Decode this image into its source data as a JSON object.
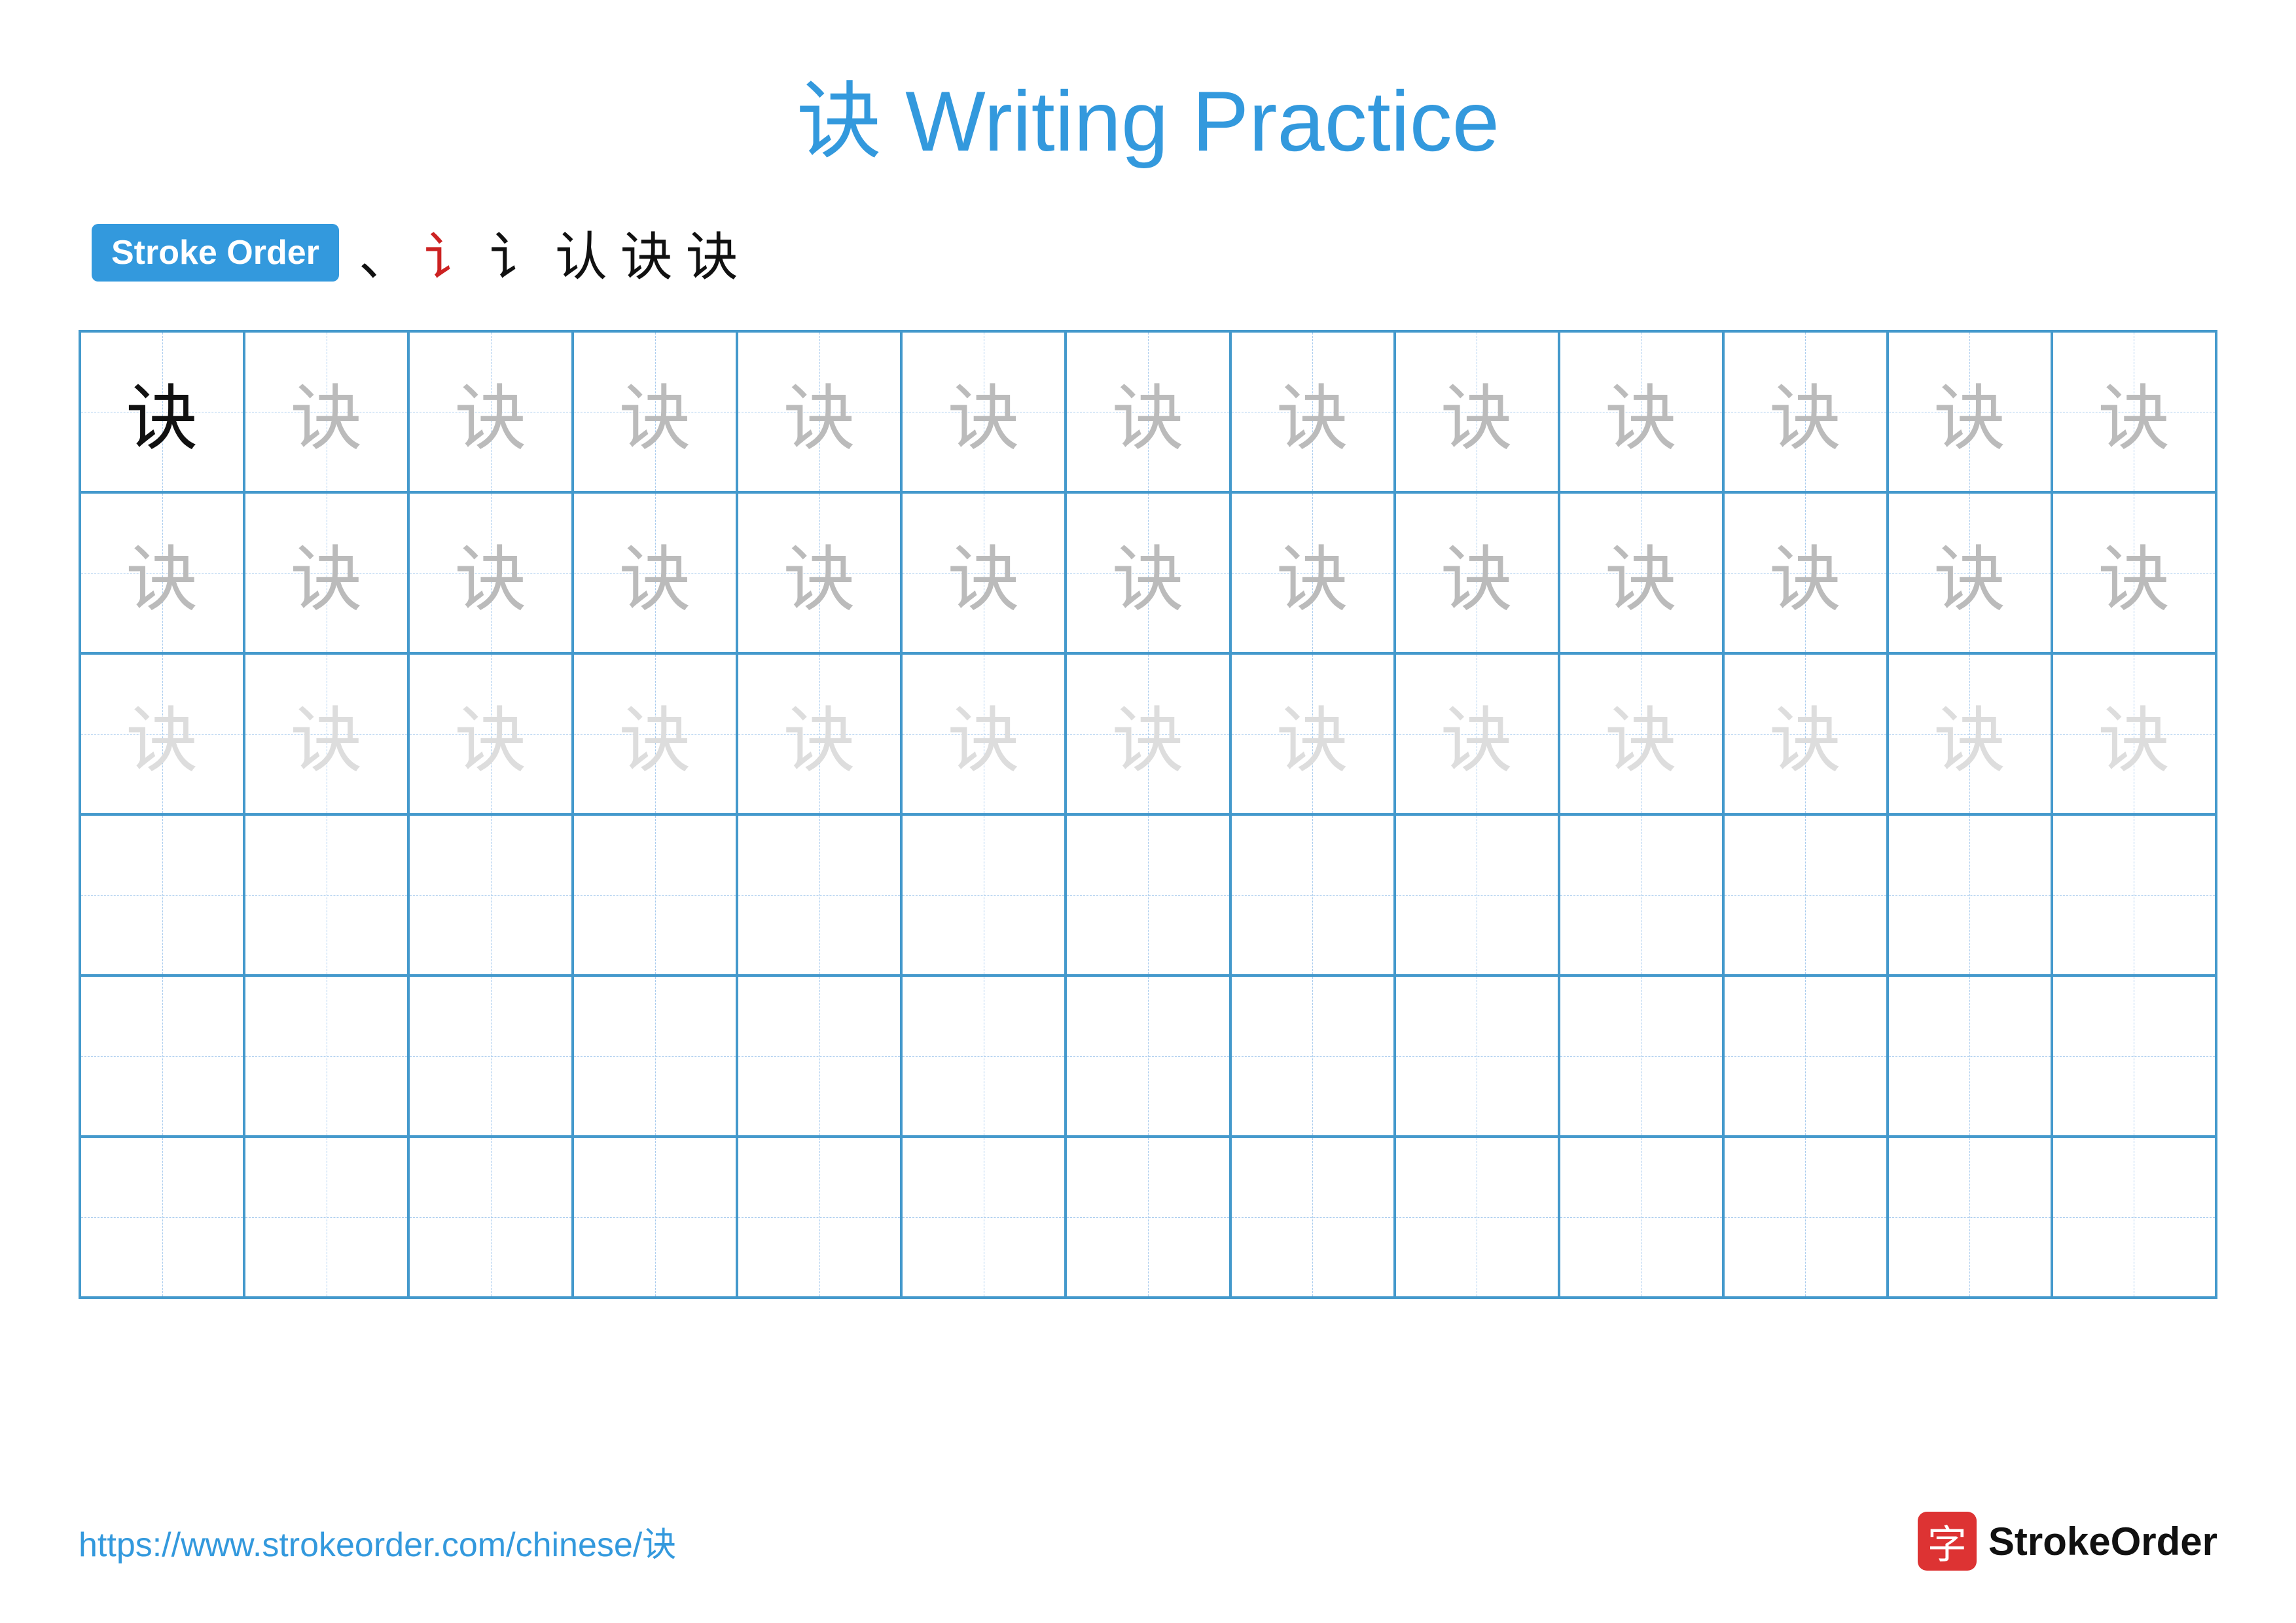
{
  "title": {
    "text": "诀 Writing Practice"
  },
  "stroke_order": {
    "badge_label": "Stroke Order",
    "strokes": [
      {
        "char": "﹀",
        "style": "black"
      },
      {
        "char": "讠",
        "style": "red"
      },
      {
        "char": "讠",
        "style": "black"
      },
      {
        "char": "认",
        "style": "black"
      },
      {
        "char": "诀",
        "style": "black"
      },
      {
        "char": "诀",
        "style": "black"
      }
    ]
  },
  "grid": {
    "rows": 6,
    "cols": 13,
    "char": "诀",
    "row_styles": [
      "dark",
      "mid",
      "light",
      "empty",
      "empty",
      "empty"
    ]
  },
  "footer": {
    "url": "https://www.strokeorder.com/chinese/诀",
    "logo_char": "字",
    "logo_text": "StrokeOrder"
  }
}
